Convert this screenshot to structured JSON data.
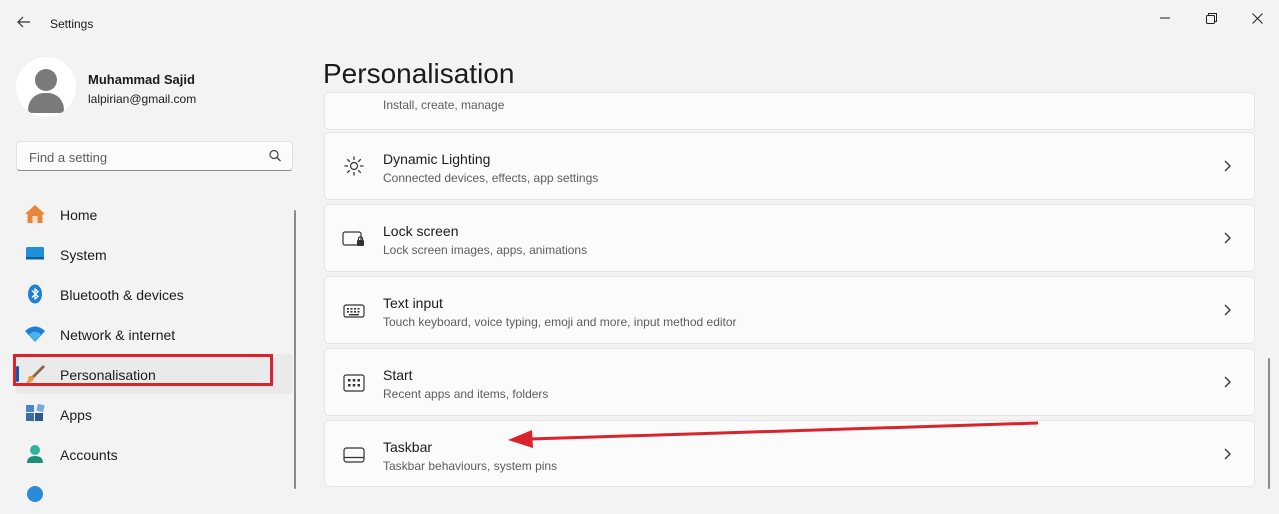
{
  "window": {
    "title": "Settings",
    "back_icon": "arrow-left-icon",
    "minimize_icon": "minimize-icon",
    "maximize_icon": "restore-icon",
    "close_icon": "close-icon"
  },
  "profile": {
    "name": "Muhammad Sajid",
    "email": "lalpirian@gmail.com"
  },
  "search": {
    "placeholder": "Find a setting"
  },
  "nav": {
    "items": [
      {
        "label": "Home",
        "icon": "home-icon"
      },
      {
        "label": "System",
        "icon": "monitor-icon"
      },
      {
        "label": "Bluetooth & devices",
        "icon": "bluetooth-icon"
      },
      {
        "label": "Network & internet",
        "icon": "wifi-icon"
      },
      {
        "label": "Personalisation",
        "icon": "paintbrush-icon",
        "active": true
      },
      {
        "label": "Apps",
        "icon": "apps-icon"
      },
      {
        "label": "Accounts",
        "icon": "person-icon"
      }
    ]
  },
  "main": {
    "title": "Personalisation",
    "partial_subtitle": "Install, create, manage",
    "cards": [
      {
        "title": "Dynamic Lighting",
        "subtitle": "Connected devices, effects, app settings",
        "icon": "dynamic-lighting-icon"
      },
      {
        "title": "Lock screen",
        "subtitle": "Lock screen images, apps, animations",
        "icon": "lock-screen-icon"
      },
      {
        "title": "Text input",
        "subtitle": "Touch keyboard, voice typing, emoji and more, input method editor",
        "icon": "keyboard-icon"
      },
      {
        "title": "Start",
        "subtitle": "Recent apps and items, folders",
        "icon": "start-menu-icon"
      },
      {
        "title": "Taskbar",
        "subtitle": "Taskbar behaviours, system pins",
        "icon": "taskbar-icon"
      }
    ]
  },
  "colors": {
    "accent": "#005fb8",
    "highlight": "#d9232d"
  }
}
